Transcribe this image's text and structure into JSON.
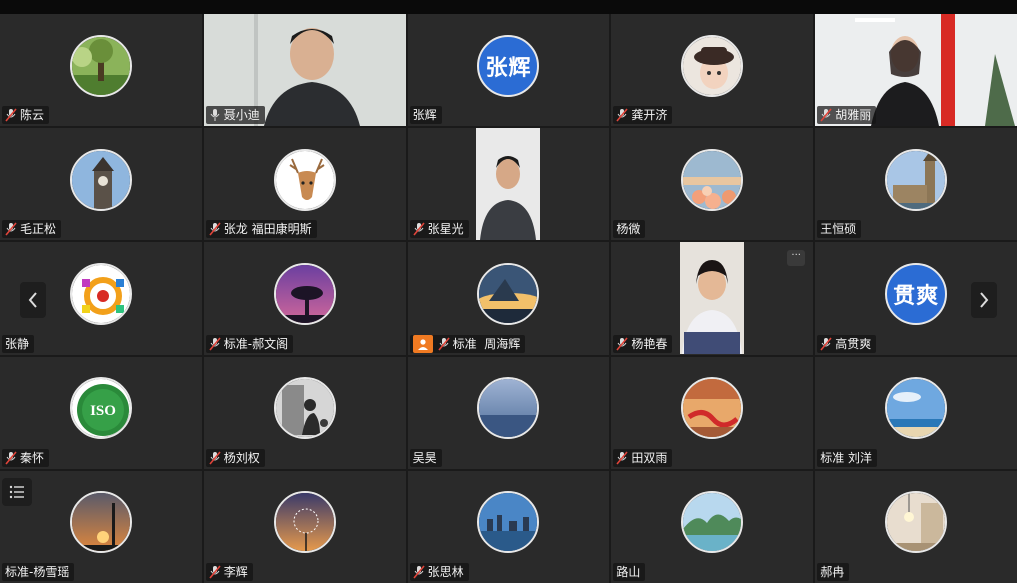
{
  "participants": [
    {
      "name": "陈云",
      "mic": "muted",
      "avatar": "tree-photo"
    },
    {
      "name": "聂小迪",
      "mic": "on",
      "video": true,
      "active": true
    },
    {
      "name": "张辉",
      "mic": "none",
      "avatar_text": "张辉"
    },
    {
      "name": "龚开济",
      "mic": "muted",
      "avatar": "child-portrait"
    },
    {
      "name": "胡雅丽",
      "mic": "muted",
      "video": true
    },
    {
      "name": "毛正松",
      "mic": "muted",
      "avatar": "clock-tower"
    },
    {
      "name": "张龙 福田康明斯",
      "mic": "muted",
      "avatar": "deer-head"
    },
    {
      "name": "张星光",
      "mic": "muted",
      "video": true
    },
    {
      "name": "杨微",
      "mic": "none",
      "avatar": "flowers-sunset"
    },
    {
      "name": "王恒硕",
      "mic": "none",
      "avatar": "big-ben"
    },
    {
      "name": "张静",
      "mic": "none",
      "avatar": "colorful-logo"
    },
    {
      "name": "标准-郝文阁",
      "mic": "muted",
      "avatar": "tree-silhouette"
    },
    {
      "name": "标准  周海辉",
      "mic": "muted",
      "avatar": "mountain-clouds",
      "person_badge": true
    },
    {
      "name": "杨艳春",
      "mic": "muted",
      "video": true,
      "more": true
    },
    {
      "name": "高贯爽",
      "mic": "muted",
      "avatar_text": "贯爽"
    },
    {
      "name": "秦怀",
      "mic": "muted",
      "avatar": "iso-badge",
      "iso_text": "ISO"
    },
    {
      "name": "杨刘权",
      "mic": "muted",
      "avatar": "bw-photo"
    },
    {
      "name": "吴昊",
      "mic": "none",
      "avatar": "sea-horizon"
    },
    {
      "name": "田双雨",
      "mic": "muted",
      "avatar": "sunset-ribbon"
    },
    {
      "name": "标准 刘洋",
      "mic": "none",
      "avatar": "beach-sky"
    },
    {
      "name": "标准-杨雪瑶",
      "mic": "none",
      "avatar": "sunset-windmill"
    },
    {
      "name": "李辉",
      "mic": "muted",
      "avatar": "dandelion"
    },
    {
      "name": "张思林",
      "mic": "muted",
      "avatar": "city-lake"
    },
    {
      "name": "路山",
      "mic": "none",
      "avatar": "river-hills"
    },
    {
      "name": "郝冉",
      "mic": "none",
      "avatar": "lamp-room"
    }
  ],
  "colors": {
    "active_border": "#2ec27e",
    "avatar_text_bg": "#2b6cd4",
    "muted_icon": "#e0443a",
    "person_badge": "#f07a22"
  },
  "controls": {
    "prev_icon": "chevron-left-icon",
    "next_icon": "chevron-right-icon",
    "menu_icon": "list-menu-icon",
    "more_text": "···"
  }
}
